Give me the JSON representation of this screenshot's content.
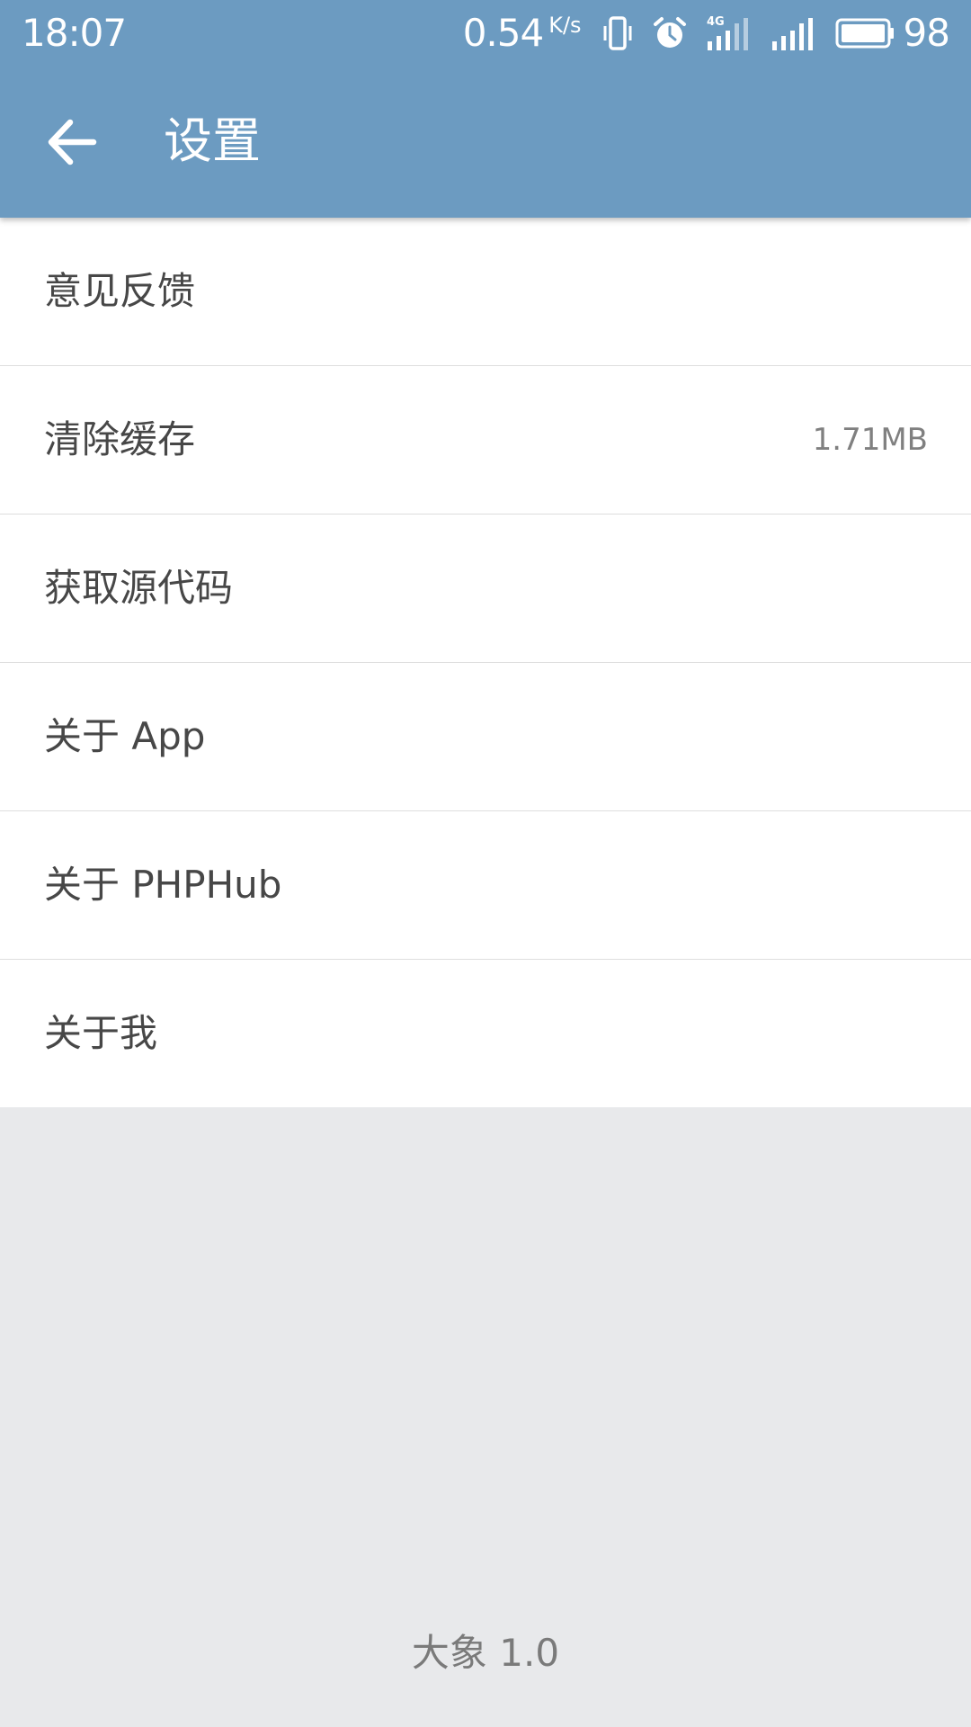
{
  "status_bar": {
    "time": "18:07",
    "net_speed": "0.54",
    "net_unit": "K/s",
    "battery_level": "98",
    "icons": [
      "vibrate-icon",
      "alarm-icon",
      "signal-4g-icon",
      "signal-icon",
      "battery-icon"
    ]
  },
  "toolbar": {
    "title": "设置",
    "back_icon": "arrow-left-icon",
    "background_color": "#6c9bc1"
  },
  "menu": {
    "items": [
      {
        "label": "意见反馈",
        "value": ""
      },
      {
        "label": "清除缓存",
        "value": "1.71MB"
      },
      {
        "label": "获取源代码",
        "value": ""
      },
      {
        "label": "关于 App",
        "value": ""
      },
      {
        "label": "关于 PHPHub",
        "value": ""
      },
      {
        "label": "关于我",
        "value": ""
      }
    ]
  },
  "footer": {
    "version": "大象 1.0"
  }
}
